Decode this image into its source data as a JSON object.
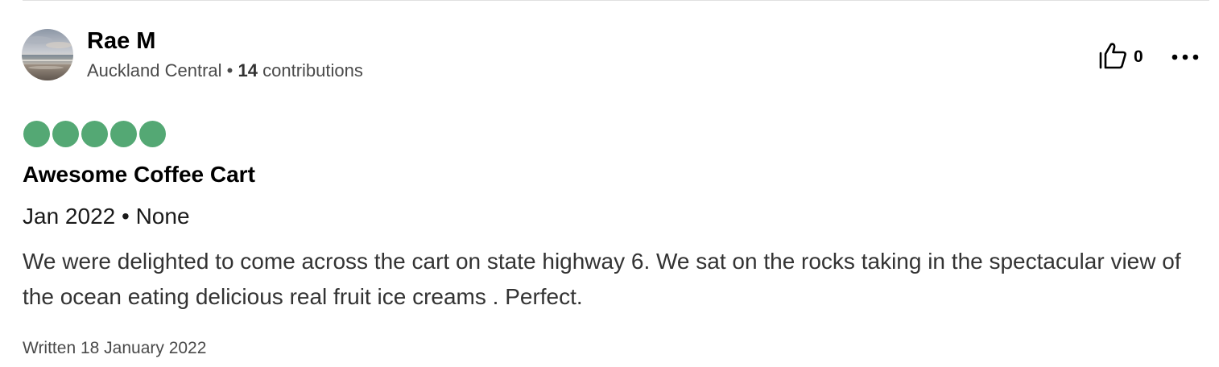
{
  "review": {
    "user": {
      "name": "Rae M",
      "location": "Auckland Central",
      "separator": "•",
      "contributions_count": "14",
      "contributions_label": "contributions",
      "avatar_icon": "beach-photo-avatar"
    },
    "helpful": {
      "icon": "thumbs-up-icon",
      "count": "0"
    },
    "more_icon": "more-horizontal-icon",
    "rating": {
      "value": 5,
      "max": 5,
      "color": "#54a874"
    },
    "title": "Awesome Coffee Cart",
    "date_line": "Jan 2022 • None",
    "body": "We were delighted to come across the cart on state highway 6. We sat on the rocks taking in the spectacular view of the ocean eating delicious real fruit ice creams . Perfect.",
    "written": "Written 18 January 2022"
  }
}
